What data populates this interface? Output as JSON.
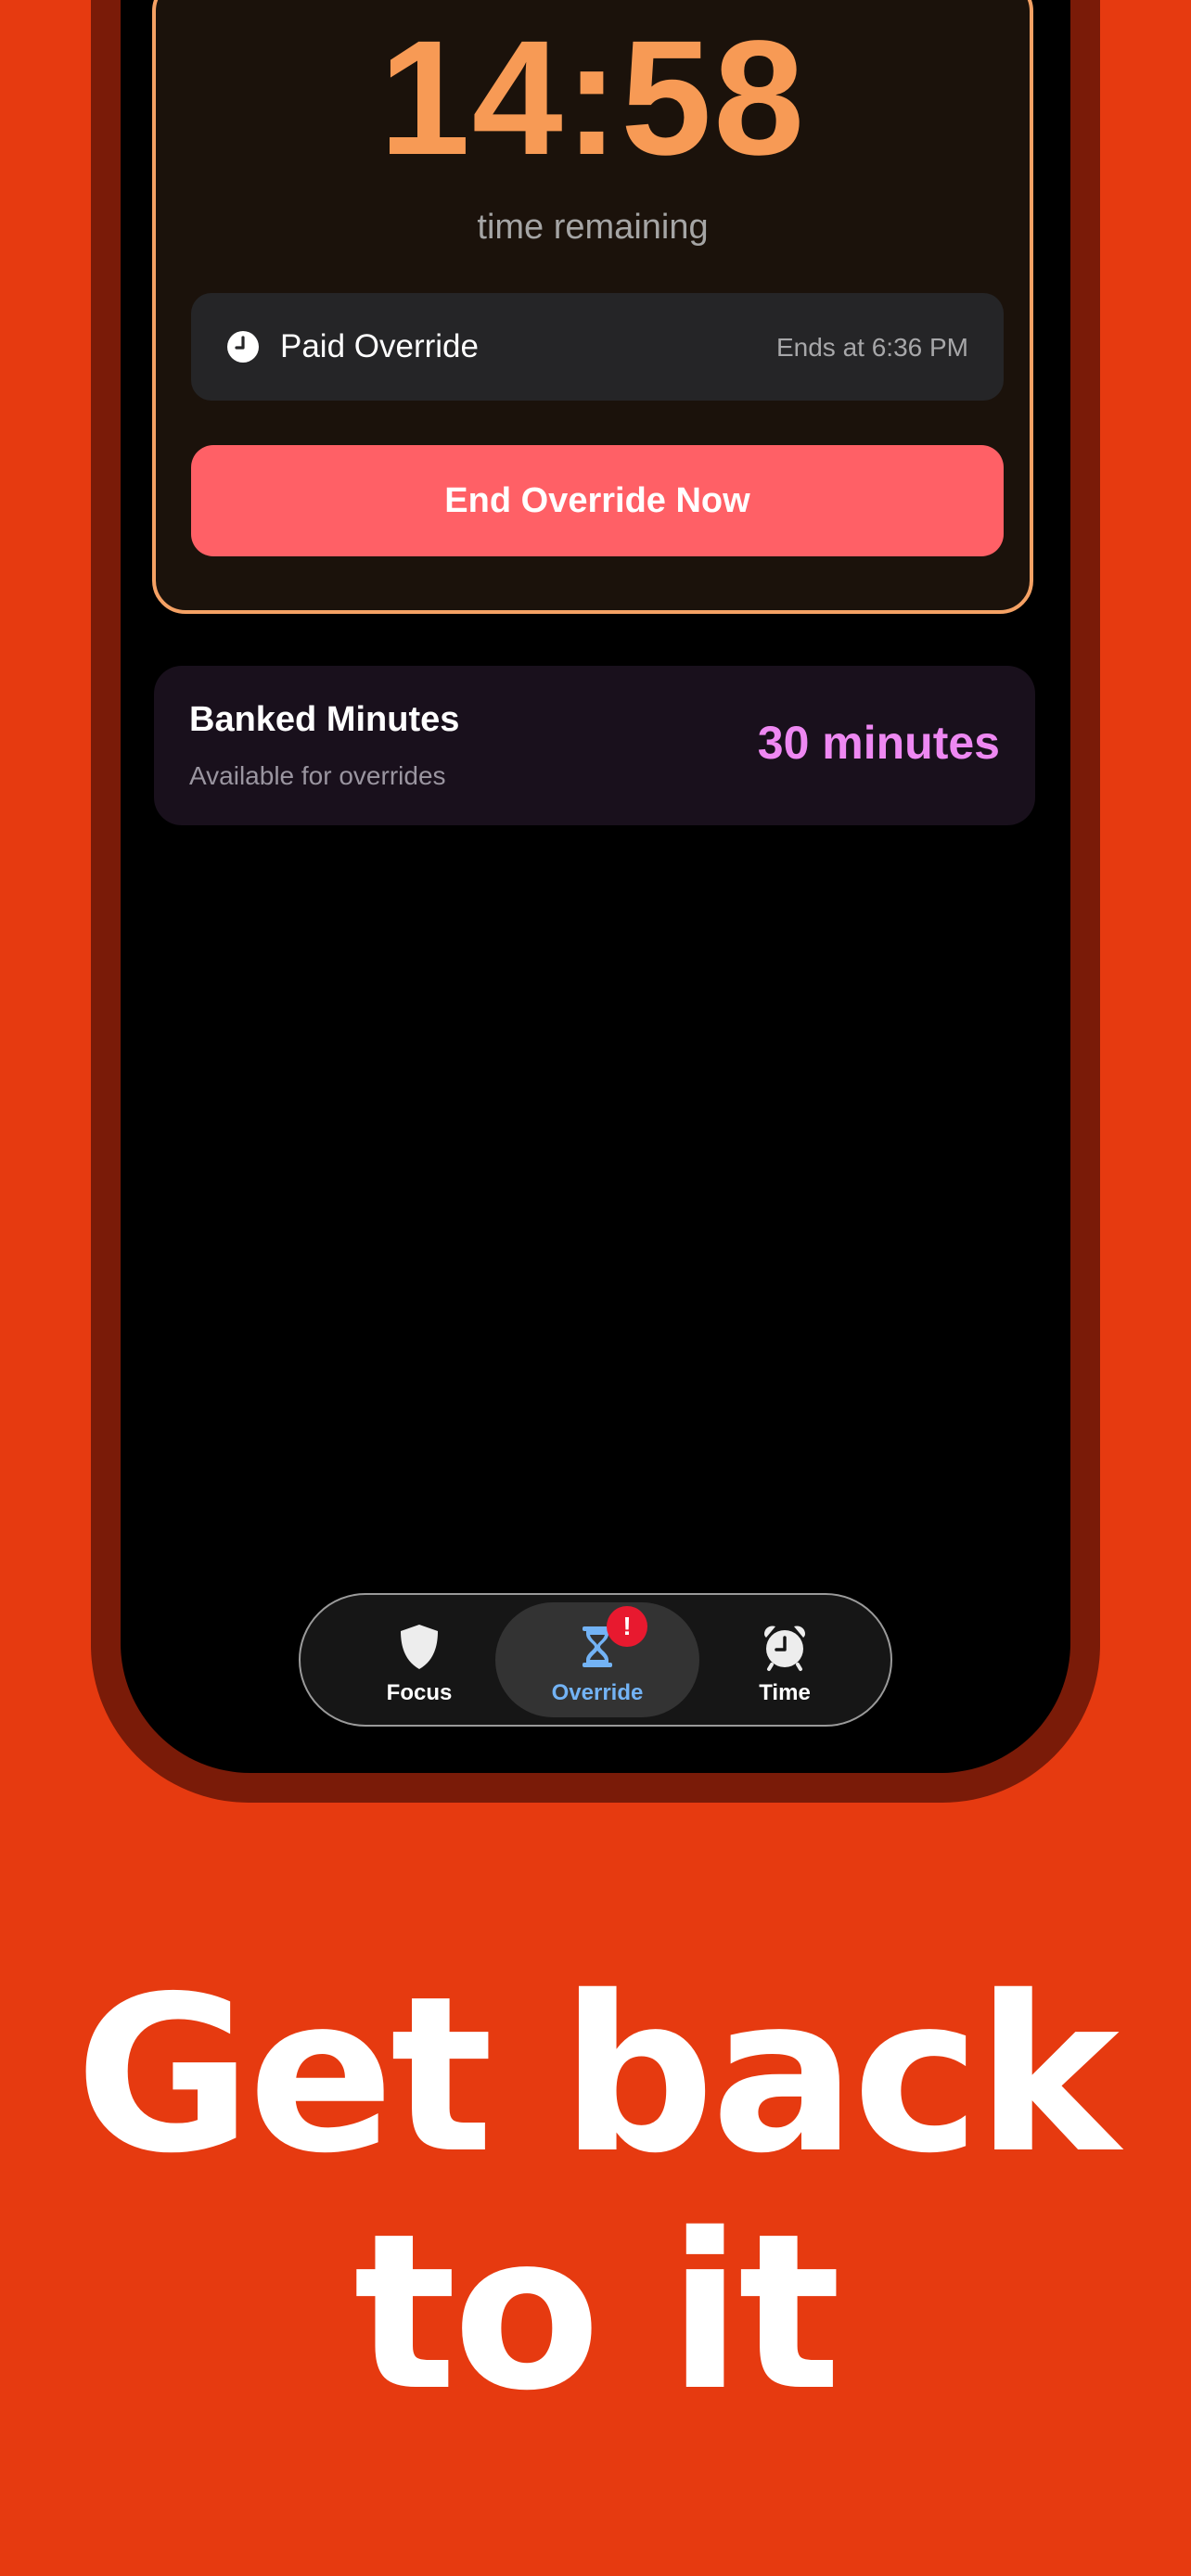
{
  "override_card": {
    "timer": "14:58",
    "caption": "time remaining",
    "status_label": "Paid Override",
    "status_ends": "Ends at 6:36 PM",
    "end_button_label": "End Override Now"
  },
  "banked": {
    "title": "Banked Minutes",
    "subtitle": "Available for overrides",
    "value": "30 minutes"
  },
  "tabs": [
    {
      "label": "Focus",
      "icon": "shield-icon"
    },
    {
      "label": "Override",
      "icon": "hourglass-icon",
      "active": true,
      "badge": "!"
    },
    {
      "label": "Time",
      "icon": "alarm-clock-icon"
    }
  ],
  "headline": {
    "line1": "Get back",
    "line2": "to it"
  },
  "colors": {
    "background": "#E63A10",
    "phone_frame": "#7A1B08",
    "timer": "#F79A55",
    "card_border": "#F5A164",
    "end_button": "#FF6066",
    "banked_value": "#EE88F2",
    "active_tab": "#73B3F5",
    "badge": "#E8192F"
  }
}
